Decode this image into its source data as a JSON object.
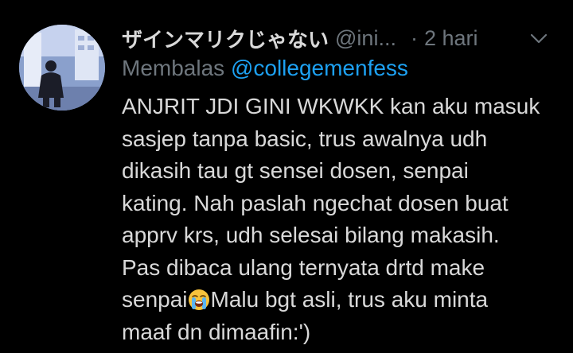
{
  "tweet": {
    "display_name": "ザインマリクじゃない",
    "handle": "@ini...",
    "separator": "·",
    "time": "2 hari",
    "reply_prefix": "Membalas",
    "reply_mention": "@collegemenfess",
    "lines": [
      "ANJRIT JDI GINI WKWKK kan aku masuk",
      "sasjep tanpa basic, trus awalnya udh",
      "dikasih tau gt sensei dosen, senpai",
      "kating. Nah paslah ngechat dosen buat",
      "apprv krs, udh selesai bilang makasih.",
      "Pas dibaca ulang ternyata drtd make"
    ],
    "line7_before": "senpai",
    "line7_after": "Malu bgt asli, trus aku minta",
    "line8": "maaf dn dimaafin:')",
    "emoji_icon": "loudly-crying-face-icon",
    "more_icon": "chevron-down-icon",
    "colors": {
      "background": "#000000",
      "text": "#d9d9d9",
      "secondary": "#6e767d",
      "link": "#1da1f2"
    }
  }
}
